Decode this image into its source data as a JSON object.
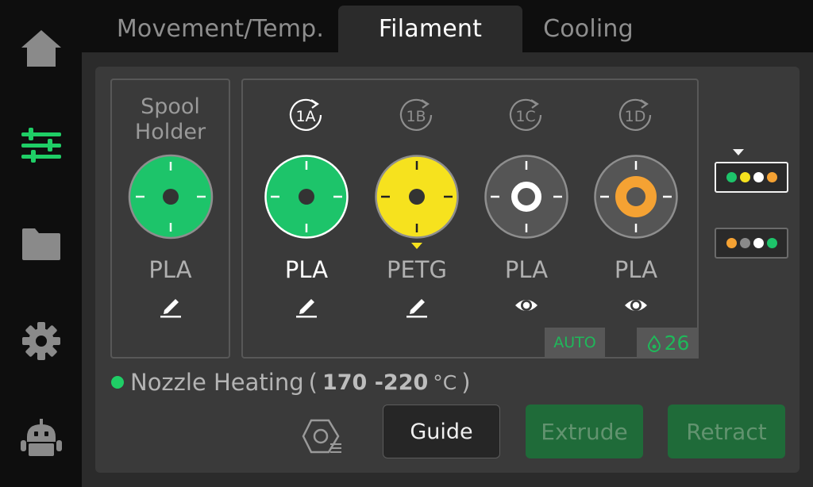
{
  "tabs": [
    {
      "label": "Movement/Temp.",
      "active": false
    },
    {
      "label": "Filament",
      "active": true
    },
    {
      "label": "Cooling",
      "active": false
    }
  ],
  "sidebar": {
    "items": [
      {
        "icon": "home-icon",
        "active": false
      },
      {
        "icon": "sliders-icon",
        "active": true
      },
      {
        "icon": "folder-icon",
        "active": false
      },
      {
        "icon": "gear-icon",
        "active": false
      },
      {
        "icon": "robot-icon",
        "active": false
      }
    ]
  },
  "spool_holder": {
    "title_line1": "Spool",
    "title_line2": "Holder",
    "material": "PLA",
    "color": "#1dc46a",
    "action_icon": "edit-icon"
  },
  "ams": {
    "slots": [
      {
        "label": "1A",
        "material": "PLA",
        "color": "#1dc46a",
        "selected": true,
        "action_icon": "edit-icon"
      },
      {
        "label": "1B",
        "material": "PETG",
        "color": "#f6e21e",
        "selected": false,
        "action_icon": "edit-icon",
        "in_use": true
      },
      {
        "label": "1C",
        "material": "PLA",
        "color": "#ffffff",
        "selected": false,
        "action_icon": "eye-icon"
      },
      {
        "label": "1D",
        "material": "PLA",
        "color": "#f5a233",
        "selected": false,
        "action_icon": "eye-icon"
      }
    ],
    "auto_label": "AUTO",
    "humidity_icon": "droplet-icon",
    "humidity_value": "26"
  },
  "ams_units": [
    {
      "selected": true,
      "dots": [
        "#1dc46a",
        "#f6e21e",
        "#ffffff",
        "#f5a233"
      ]
    },
    {
      "selected": false,
      "dots": [
        "#f5a233",
        "#8a8a8a",
        "#ffffff",
        "#1dc46a"
      ]
    }
  ],
  "status": {
    "label": "Nozzle Heating",
    "range": "170 -220",
    "unit": "°C",
    "open_paren": "(",
    "close_paren": ")"
  },
  "actions": {
    "guide": "Guide",
    "extrude": "Extrude",
    "retract": "Retract"
  },
  "colors": {
    "accent_green": "#1fce66",
    "button_green": "#1f6b39"
  }
}
